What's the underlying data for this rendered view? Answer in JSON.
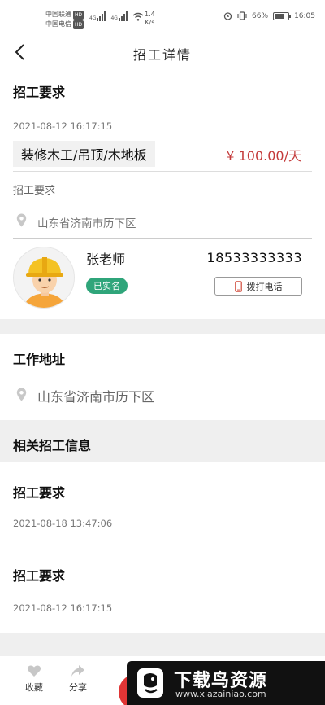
{
  "status": {
    "carrier1": "中国联通",
    "carrier2": "中国电信",
    "hd": "HD",
    "net1": "4G",
    "net2": "4G",
    "speed_value": "1.4",
    "speed_unit": "K/s",
    "battery": "66%",
    "battery_level": 0.66,
    "time": "16:05"
  },
  "nav": {
    "title": "招工详情"
  },
  "job": {
    "title": "招工要求",
    "date": "2021-08-12 16:17:15",
    "tag": "装修木工/吊顶/木地板",
    "price": "¥ 100.00/天",
    "requirement_label": "招工要求",
    "location": "山东省济南市历下区"
  },
  "contact": {
    "name": "张老师",
    "verified": "已实名",
    "phone": "18533333333",
    "call_label": "拨打电话"
  },
  "work_address": {
    "title": "工作地址",
    "address": "山东省济南市历下区"
  },
  "related": {
    "header": "相关招工信息",
    "items": [
      {
        "title": "招工要求",
        "date": "2021-08-18 13:47:06"
      },
      {
        "title": "招工要求",
        "date": "2021-08-12 16:17:15"
      }
    ]
  },
  "bottom": {
    "collect_label": "收藏",
    "share_label": "分享"
  },
  "watermark": {
    "title": "下载鸟资源",
    "url": "www.xiazainiao.com"
  },
  "colors": {
    "price": "#c43a3a",
    "verified": "#2fa57a",
    "primary_button": "#e03535",
    "gap": "#efefef"
  }
}
